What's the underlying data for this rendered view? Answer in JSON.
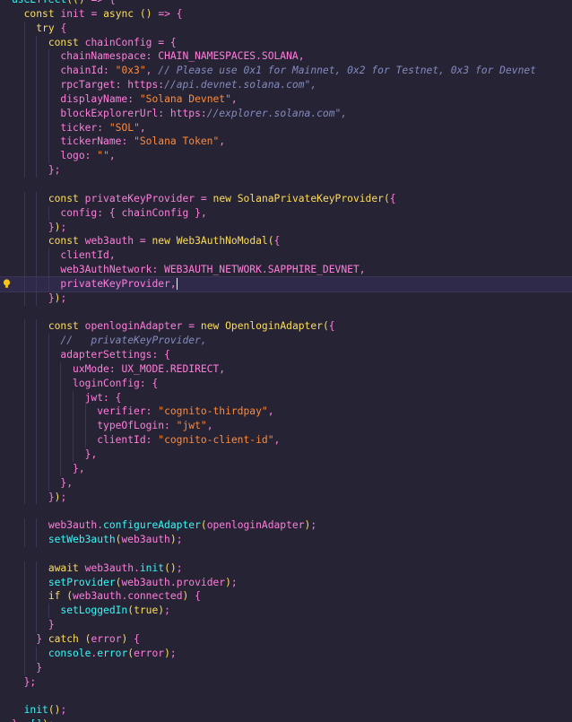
{
  "editor": {
    "language": "javascript",
    "active_line_index": 20,
    "lines": [
      "useEffect(() => {",
      "  const init = async () => {",
      "    try {",
      "      const chainConfig = {",
      "        chainNamespace: CHAIN_NAMESPACES.SOLANA,",
      "        chainId: \"0x3\", // Please use 0x1 for Mainnet, 0x2 for Testnet, 0x3 for Devnet",
      "        rpcTarget: \"https://api.devnet.solana.com\",",
      "        displayName: \"Solana Devnet\",",
      "        blockExplorerUrl: \"https://explorer.solana.com\",",
      "        ticker: \"SOL\",",
      "        tickerName: \"Solana Token\",",
      "        logo: \"\",",
      "      };",
      "",
      "      const privateKeyProvider = new SolanaPrivateKeyProvider({",
      "        config: { chainConfig },",
      "      });",
      "      const web3auth = new Web3AuthNoModal({",
      "        clientId,",
      "        web3AuthNetwork: WEB3AUTH_NETWORK.SAPPHIRE_DEVNET,",
      "        privateKeyProvider,",
      "      });",
      "",
      "      const openloginAdapter = new OpenloginAdapter({",
      "        //   privateKeyProvider,",
      "        adapterSettings: {",
      "          uxMode: UX_MODE.REDIRECT,",
      "          loginConfig: {",
      "            jwt: {",
      "              verifier: \"cognito-thirdpay\",",
      "              typeOfLogin: \"jwt\",",
      "              clientId: \"cognito-client-id\",",
      "            },",
      "          },",
      "        },",
      "      });",
      "",
      "      web3auth.configureAdapter(openloginAdapter);",
      "      setWeb3auth(web3auth);",
      "",
      "      await web3auth.init();",
      "      setProvider(web3auth.provider);",
      "      if (web3auth.connected) {",
      "        setLoggedIn(true);",
      "      }",
      "    } catch (error) {",
      "      console.error(error);",
      "    }",
      "  };",
      "",
      "  init();",
      "}, []);"
    ]
  },
  "icons": {
    "lightbulb": "lightbulb-icon"
  },
  "colors": {
    "background": "#262335",
    "keyword": "#fede5d",
    "identifier": "#ff7edb",
    "function_cyan": "#36f9f6",
    "string": "#ff8b39",
    "comment": "#848bbd",
    "active_line": "#2f2a4a"
  }
}
